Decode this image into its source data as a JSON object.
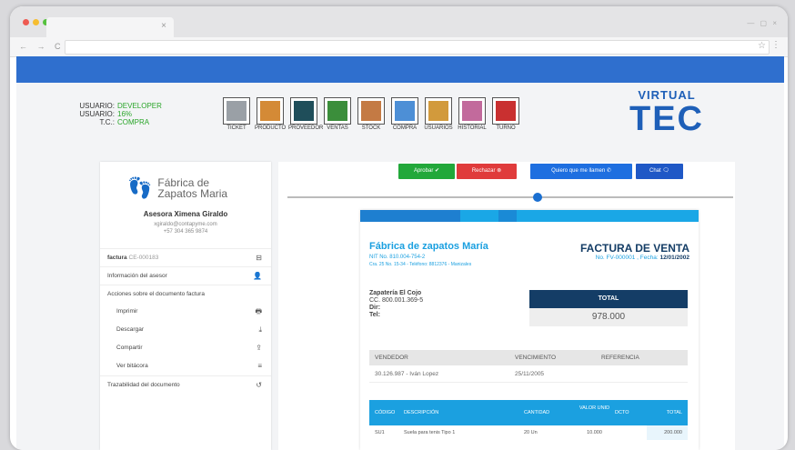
{
  "browser": {
    "tab_close": "×",
    "nav": "← → C",
    "win_controls": "— ▢ ×",
    "star": "☆",
    "kebab": "⋮"
  },
  "user": {
    "rows": [
      {
        "label": "USUARIO:",
        "value": "DEVELOPER"
      },
      {
        "label": "USUARIO:",
        "value": "16%"
      },
      {
        "label": "T.C.:",
        "value": "COMPRA"
      }
    ]
  },
  "toolbar": [
    {
      "label": "TICKET",
      "icon": "ticket-icon",
      "color": "#9aa0a6"
    },
    {
      "label": "PRODUCTO",
      "icon": "product-box-icon",
      "color": "#d48a36"
    },
    {
      "label": "PROVEEDOR",
      "icon": "supplier-icon",
      "color": "#1f4e5a"
    },
    {
      "label": "VENTAS",
      "icon": "sales-chart-icon",
      "color": "#3b8e3b"
    },
    {
      "label": "STOCK",
      "icon": "stock-boxes-icon",
      "color": "#c47a44"
    },
    {
      "label": "COMPRA",
      "icon": "purchase-icon",
      "color": "#4d8fd6"
    },
    {
      "label": "USUARIOS",
      "icon": "users-icon",
      "color": "#d29a3c"
    },
    {
      "label": "HISTORIAL",
      "icon": "history-books-icon",
      "color": "#c26a9c"
    },
    {
      "label": "TURNO",
      "icon": "shift-calendar-icon",
      "color": "#c93030"
    }
  ],
  "logo": {
    "line1": "VIRTUAL",
    "line2": "TEC"
  },
  "sidebar": {
    "brand": "Fábrica de Zapatos Maria",
    "advisor_name": "Asesora Ximena Giraldo",
    "advisor_email": "xgiraldo@contapyme.com",
    "advisor_phone": "+57 304 365 9874",
    "items": [
      {
        "label": "factura",
        "suffix": " CE-000183",
        "icon": "⊟",
        "icon_name": "document-icon",
        "sub": false
      },
      {
        "label": "Información del asesor",
        "suffix": "",
        "icon": "👤",
        "icon_name": "user-icon",
        "sub": false
      },
      {
        "label": "Acciones sobre el documento factura",
        "suffix": "",
        "icon": "",
        "icon_name": "",
        "sub": false
      },
      {
        "label": "Imprimir",
        "suffix": "",
        "icon": "🖶",
        "icon_name": "print-icon",
        "sub": true
      },
      {
        "label": "Descargar",
        "suffix": "",
        "icon": "⤓",
        "icon_name": "download-icon",
        "sub": true
      },
      {
        "label": "Compartir",
        "suffix": "",
        "icon": "⇪",
        "icon_name": "share-icon",
        "sub": true
      },
      {
        "label": "Ver bitácora",
        "suffix": "",
        "icon": "≡",
        "icon_name": "log-icon",
        "sub": true
      },
      {
        "label": "Trazabilidad del documento",
        "suffix": "",
        "icon": "↺",
        "icon_name": "history-icon",
        "sub": false
      }
    ]
  },
  "actions": {
    "approve": "Aprobar ✔",
    "reject": "Rechazar ⊗",
    "call": "Quiero que me llamen ✆",
    "chat": "Chat 🗨"
  },
  "colors": {
    "approve": "#22a83a",
    "reject": "#e03b3b",
    "call": "#1e6fe0",
    "chat": "#1f58c6"
  },
  "slider": {
    "value": 0.55
  },
  "invoice": {
    "company": "Fábrica de zapatos María",
    "nit": "NIT No. 810.004-754-2",
    "address": "Cra. 25 No. 15-34 - Teléfono: 8812376 - Manizales",
    "title": "FACTURA DE VENTA",
    "number_label": "No. FV-000001 , Fecha: ",
    "date": "12/01/2002",
    "client_name": "Zapatería El Cojo",
    "client_cc": "CC. 800.001.369-5",
    "client_dir": "Dir:",
    "client_tel": "Tel:",
    "total_label": "TOTAL",
    "total_value": "978.000",
    "vendor_headers": [
      "VENDEDOR",
      "VENCIMIENTO",
      "REFERENCIA"
    ],
    "vendor_row": [
      "30.126.987 - Iván Lopez",
      "25/11/2005",
      ""
    ],
    "item_headers": [
      "CÓDIGO",
      "DESCRIPCIÓN",
      "CANTIDAD",
      "VALOR UNID",
      "DCTO",
      "TOTAL"
    ],
    "items": [
      [
        "SU1",
        "Suela para tenis Tipo 1",
        "20 Un",
        "10.000",
        "",
        "200.000"
      ]
    ]
  }
}
